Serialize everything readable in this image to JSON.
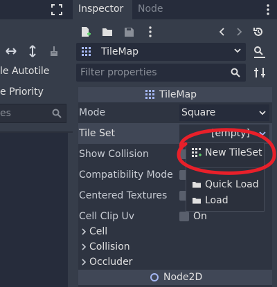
{
  "left_panel": {
    "rows": [
      {
        "label": "le Autotile"
      },
      {
        "label": "e Priority"
      }
    ],
    "search_placeholder": "es"
  },
  "dock": {
    "tabs": [
      {
        "label": "Inspector",
        "active": true
      },
      {
        "label": "Node",
        "active": false
      }
    ],
    "node_selector": {
      "label": "TileMap"
    },
    "filter": {
      "placeholder": "Filter properties"
    }
  },
  "properties": {
    "section_title": "TileMap",
    "rows": [
      {
        "name": "Mode",
        "value": "Square",
        "kind": "dropdown"
      },
      {
        "name": "Tile Set",
        "value": "[empty]",
        "kind": "resource"
      },
      {
        "name": "Show Collision",
        "kind": "checkbox"
      },
      {
        "name": "Compatibility Mode",
        "kind": "checkbox"
      },
      {
        "name": "Centered Textures",
        "kind": "checkbox"
      },
      {
        "name": "Cell Clip Uv",
        "value": "On",
        "kind": "checkbox"
      }
    ],
    "groups": [
      {
        "label": "Cell"
      },
      {
        "label": "Collision"
      },
      {
        "label": "Occluder"
      }
    ],
    "node2d_title": "Node2D"
  },
  "popup_menu": {
    "items": [
      {
        "label": "New TileSet",
        "icon": "tileset-icon"
      },
      {
        "label": "Quick Load",
        "icon": "folder-icon"
      },
      {
        "label": "Load",
        "icon": "folder-icon"
      }
    ]
  },
  "colors": {
    "background": "#363d4a",
    "panel_dark": "#262c3b",
    "property_bg": "#2e3441",
    "section_header": "#404756",
    "annotation": "#e8202a"
  }
}
